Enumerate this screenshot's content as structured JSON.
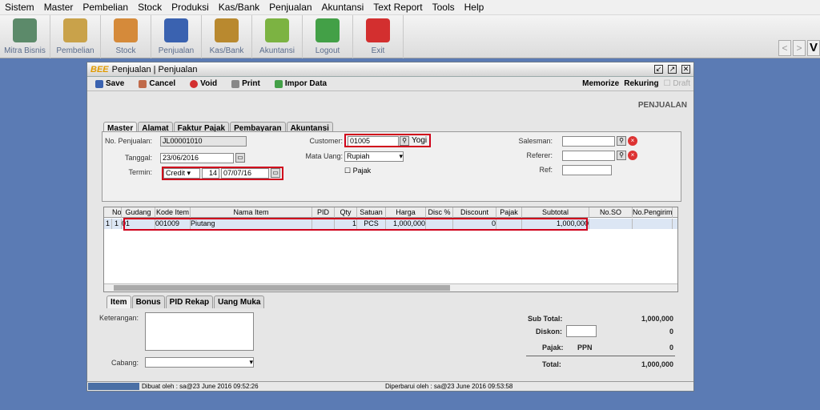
{
  "menu": [
    "Sistem",
    "Master",
    "Pembelian",
    "Stock",
    "Produksi",
    "Kas/Bank",
    "Penjualan",
    "Akuntansi",
    "Text Report",
    "Tools",
    "Help"
  ],
  "toolbar": [
    {
      "label": "Mitra Bisnis",
      "color": "#5c8a6a"
    },
    {
      "label": "Pembelian",
      "color": "#c9a24a"
    },
    {
      "label": "Stock",
      "color": "#d58a3a"
    },
    {
      "label": "Penjualan",
      "color": "#3a62b0"
    },
    {
      "label": "Kas/Bank",
      "color": "#b9892f"
    },
    {
      "label": "Akuntansi",
      "color": "#7cb342"
    },
    {
      "label": "Logout",
      "color": "#43a047"
    },
    {
      "label": "Exit",
      "color": "#d32f2f"
    }
  ],
  "nav": {
    "prev": "<",
    "next": ">",
    "v": "V"
  },
  "window": {
    "logo": "BEE",
    "title": "Penjualan | Penjualan",
    "actions": [
      "Save",
      "Cancel",
      "Void",
      "Print",
      "Impor Data"
    ],
    "right": [
      "Memorize",
      "Rekuring",
      "Draft"
    ],
    "heading": "PENJUALAN"
  },
  "tabs": [
    "Master",
    "Alamat",
    "Faktur Pajak",
    "Pembayaran",
    "Akuntansi"
  ],
  "form": {
    "no_penjualan_label": "No. Penjualan:",
    "no_penjualan": "JL00001010",
    "tanggal_label": "Tanggal:",
    "tanggal": "23/06/2016",
    "termin_label": "Termin:",
    "termin": "Credit",
    "termin_days": "14",
    "termin_date": "07/07/16",
    "customer_label": "Customer:",
    "customer_code": "01005",
    "customer_name": "Yogi",
    "mata_uang_label": "Mata Uang:",
    "mata_uang": "Rupiah",
    "pajak_label": "Pajak",
    "salesman_label": "Salesman:",
    "referer_label": "Referer:",
    "ref_label": "Ref:"
  },
  "grid": {
    "headers": [
      "No",
      "Gudang",
      "Kode Item",
      "Nama Item",
      "PID",
      "Qty",
      "Satuan",
      "Harga",
      "Disc %",
      "Discount",
      "Pajak",
      "Subtotal",
      "No.SO",
      "No.Pengiriman"
    ],
    "row": [
      "1",
      "1",
      "01",
      "001009",
      "Piutang",
      "",
      "1",
      "PCS",
      "1,000,000",
      "",
      "0",
      "",
      "1,000,000",
      "",
      ""
    ]
  },
  "bottom_tabs": [
    "Item",
    "Bonus",
    "PID Rekap",
    "Uang Muka"
  ],
  "bottom": {
    "keterangan_label": "Keterangan:",
    "cabang_label": "Cabang:",
    "subtotal_label": "Sub Total:",
    "subtotal": "1,000,000",
    "diskon_label": "Diskon:",
    "diskon": "0",
    "pajak_label": "Pajak:",
    "pajak_type": "PPN",
    "pajak": "0",
    "total_label": "Total:",
    "total": "1,000,000"
  },
  "status": {
    "dibuat": "Dibuat oleh : sa@23 June 2016  09:52:26",
    "diperbarui": "Diperbarui oleh : sa@23 June 2016  09:53:58"
  }
}
